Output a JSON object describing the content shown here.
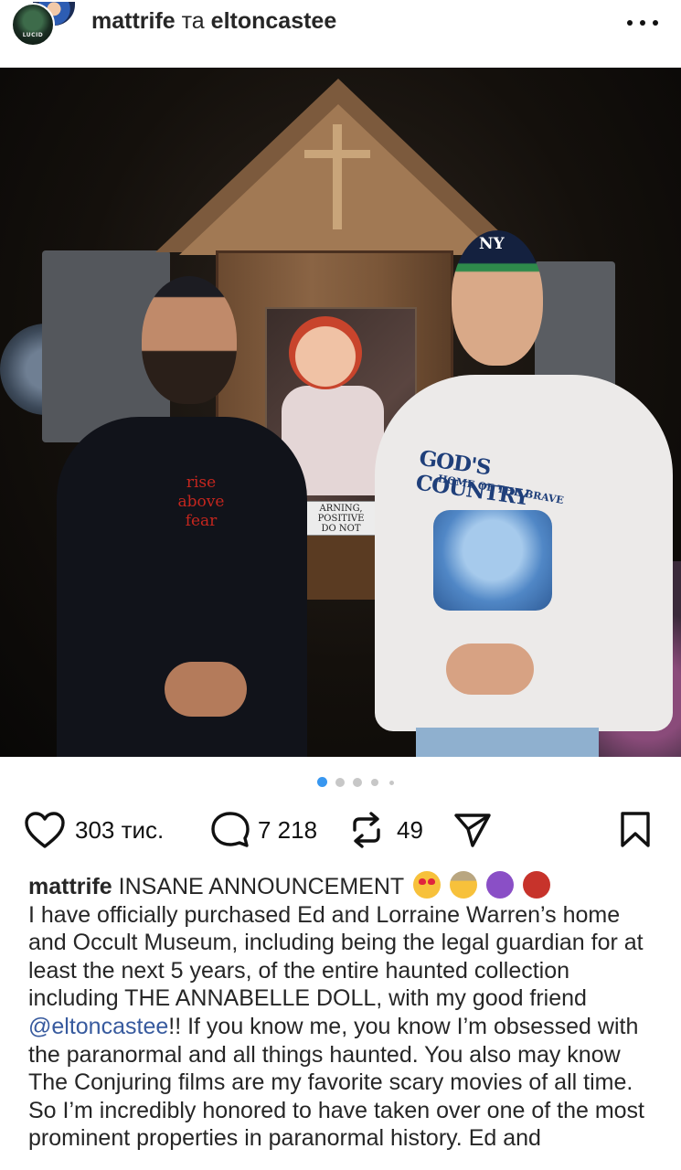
{
  "header": {
    "title_user1": "mattrife",
    "title_conj": "та",
    "title_user2": "eltoncastee",
    "avatar_logo": "LUCID"
  },
  "post_image": {
    "shirt_text": [
      "rise",
      "above",
      "fear"
    ],
    "sign_text": [
      "ARNING,",
      "POSITIVE",
      "DO NOT"
    ],
    "cap_logo": "NY",
    "tee_title": "GOD'S COUNTRY",
    "tee_subtitle": "HOME OF THE BRAVE"
  },
  "carousel": {
    "total": 5,
    "active_index": 0
  },
  "actions": {
    "likes": "303 тис.",
    "comments": "7 218",
    "reposts": "49"
  },
  "icons": {
    "more": "more-options-icon",
    "like": "heart-icon",
    "comment": "comment-icon",
    "repost": "repost-icon",
    "share": "send-icon",
    "save": "bookmark-icon"
  },
  "caption": {
    "username": "mattrife",
    "headline": "INSANE ANNOUNCEMENT",
    "text_before_mention": "I have officially purchased Ed and Lorraine Warren’s home and Occult Museum, including being the legal guardian for at least the next 5 years, of the entire haunted collection including THE ANNABELLE DOLL, with my good friend ",
    "mention": "@eltoncastee",
    "text_after_mention": "!! If you know me, you know I’m obsessed with the paranormal and all things haunted. You also may know The Conjuring films are my favorite scary movies of all time. So I’m incredibly honored to have taken over one of the most prominent properties in paranormal history. Ed and"
  },
  "colors": {
    "text": "#262626",
    "mention": "#375a9e",
    "dot_active": "#3897f0",
    "dot_inactive": "#c7c7c7"
  }
}
